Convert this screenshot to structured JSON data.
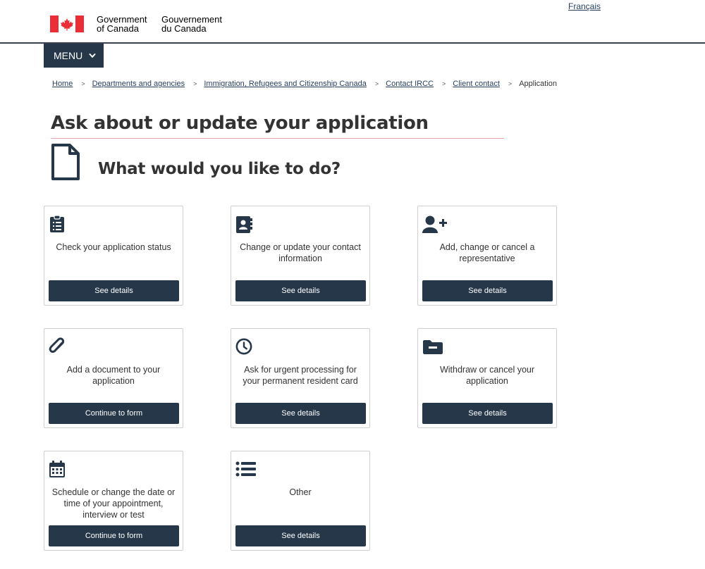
{
  "header": {
    "language_link": "Français",
    "signature_en": "Government\nof Canada",
    "signature_fr": "Gouvernement\ndu Canada",
    "menu_label": "MENU"
  },
  "breadcrumb": [
    {
      "label": "Home",
      "link": true
    },
    {
      "label": "Departments and agencies",
      "link": true
    },
    {
      "label": "Immigration, Refugees and Citizenship Canada",
      "link": true
    },
    {
      "label": "Contact IRCC",
      "link": true
    },
    {
      "label": "Client contact",
      "link": true
    },
    {
      "label": "Application",
      "link": false
    }
  ],
  "page": {
    "title": "Ask about or update your application",
    "subtitle": "What would you like to do?"
  },
  "cards": [
    {
      "icon": "clipboard-icon",
      "label": "Check your application status",
      "button": "See details"
    },
    {
      "icon": "contact-book-icon",
      "label": "Change or update your contact information",
      "button": "See details"
    },
    {
      "icon": "user-plus-icon",
      "label": "Add, change or cancel a representative",
      "button": "See details"
    },
    {
      "icon": "paperclip-icon",
      "label": "Add a document to your application",
      "button": "Continue to form"
    },
    {
      "icon": "clock-icon",
      "label": "Ask for urgent processing for your permanent resident card",
      "button": "See details"
    },
    {
      "icon": "folder-minus-icon",
      "label": "Withdraw or cancel your application",
      "button": "See details"
    },
    {
      "icon": "calendar-icon",
      "label": "Schedule or change the date or time of your appointment, interview or test",
      "button": "Continue to form"
    },
    {
      "icon": "list-icon",
      "label": "Other",
      "button": "See details"
    }
  ],
  "colors": {
    "primary": "#26374a",
    "link": "#284162",
    "flag_red": "#eb2d37",
    "title_underline": "#e8a0aa"
  }
}
